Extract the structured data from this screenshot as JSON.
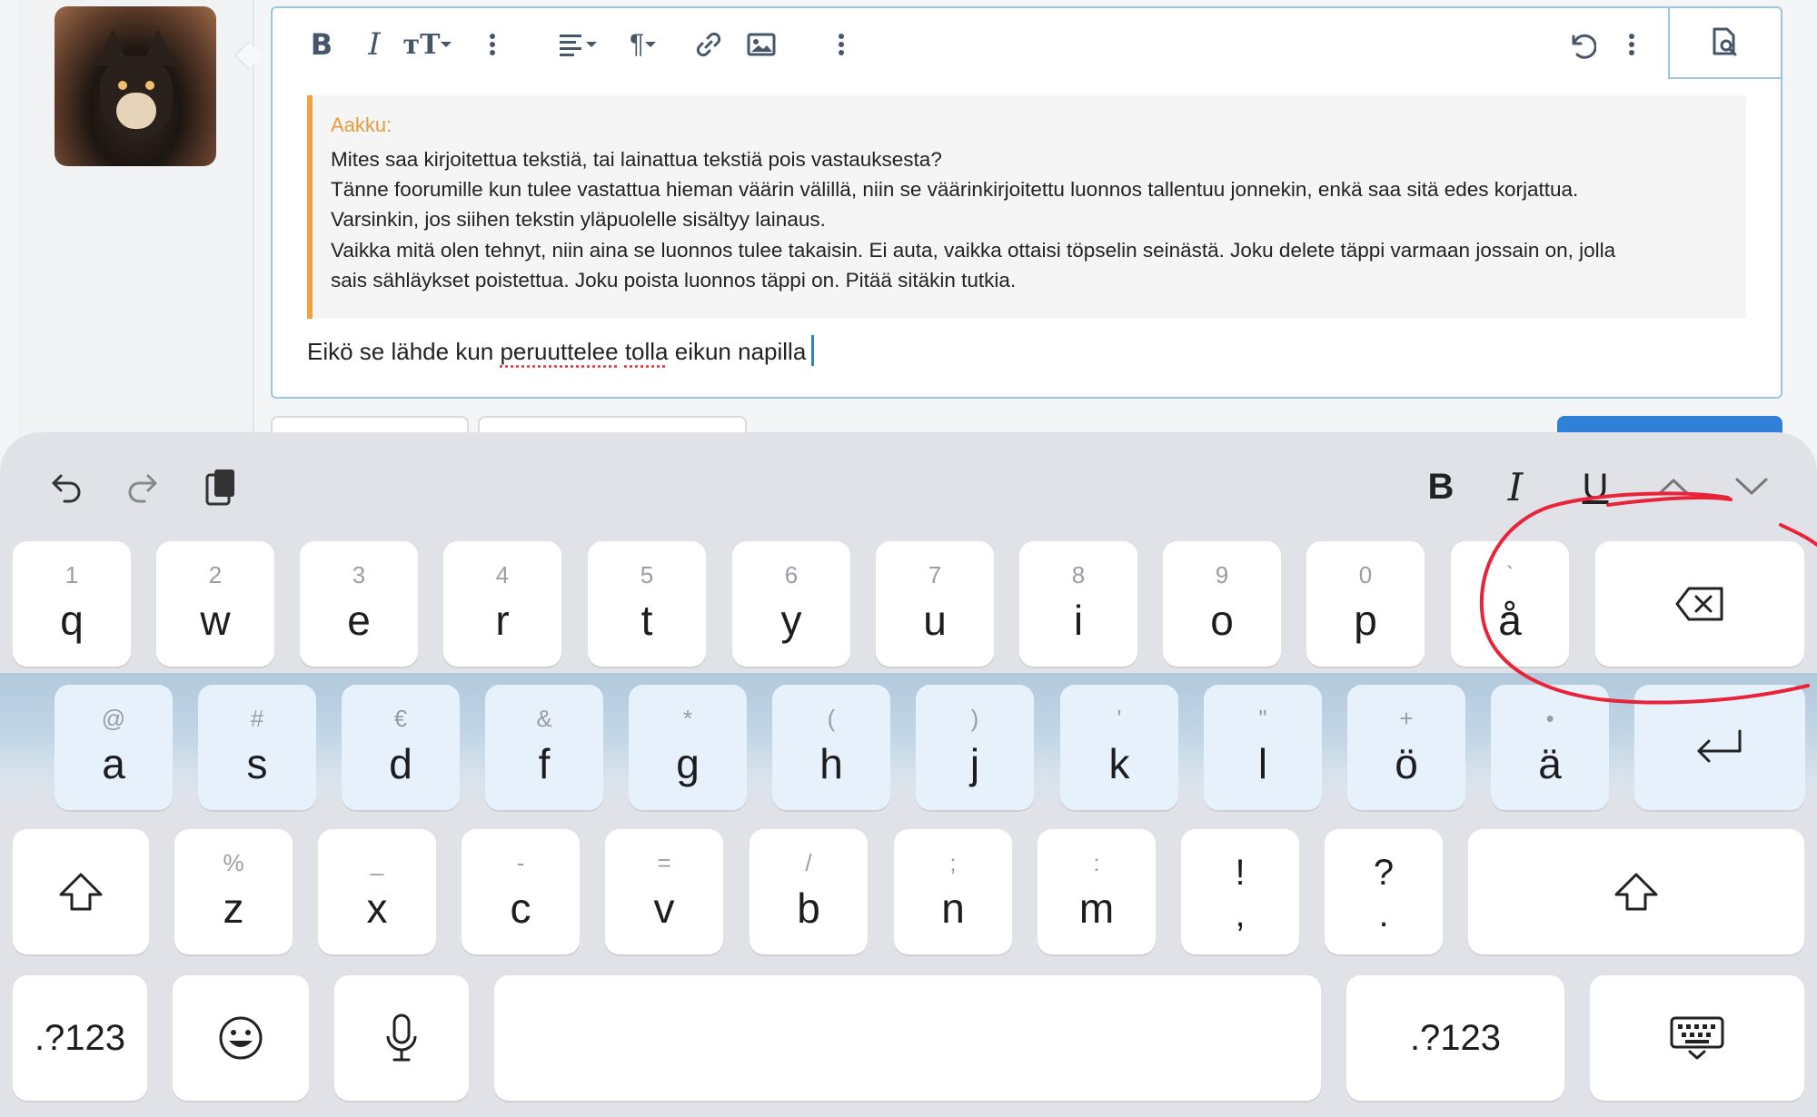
{
  "editor": {
    "toolbar": {
      "bold": "B",
      "italic": "I",
      "text_size": "тТ",
      "paragraph": "¶"
    },
    "quote": {
      "author": "Aakku:",
      "lines": [
        "Mites saa kirjoitettua tekstiä, tai lainattua tekstiä pois vastauksesta?",
        "Tänne foorumille kun tulee vastattua hieman väärin välillä, niin se väärinkirjoitettu luonnos tallentuu jonnekin, enkä saa sitä edes korjattua.",
        "Varsinkin, jos siihen tekstin yläpuolelle sisältyy lainaus.",
        "Vaikka mitä olen tehnyt, niin aina se luonnos tulee takaisin. Ei auta, vaikka ottaisi töpselin seinästä. Joku delete täppi varmaan jossain on, jolla",
        "sais sähläykset poistettua. Joku poista luonnos täppi on. Pitää sitäkin tutkia."
      ]
    },
    "reply": {
      "w1": "Eikö se lähde kun ",
      "w2": "peruuttelee",
      "w3": " ",
      "w4": "tolla",
      "w5": " eikun napilla"
    }
  },
  "keyboard": {
    "toolbar": {
      "bold": "B",
      "italic": "I",
      "underline": "U"
    },
    "row1": [
      {
        "hint": "1",
        "key": "q"
      },
      {
        "hint": "2",
        "key": "w"
      },
      {
        "hint": "3",
        "key": "e"
      },
      {
        "hint": "4",
        "key": "r"
      },
      {
        "hint": "5",
        "key": "t"
      },
      {
        "hint": "6",
        "key": "y"
      },
      {
        "hint": "7",
        "key": "u"
      },
      {
        "hint": "8",
        "key": "i"
      },
      {
        "hint": "9",
        "key": "o"
      },
      {
        "hint": "0",
        "key": "p"
      },
      {
        "hint": "`",
        "key": "å"
      }
    ],
    "row2": [
      {
        "hint": "@",
        "key": "a"
      },
      {
        "hint": "#",
        "key": "s"
      },
      {
        "hint": "€",
        "key": "d"
      },
      {
        "hint": "&",
        "key": "f"
      },
      {
        "hint": "*",
        "key": "g"
      },
      {
        "hint": "(",
        "key": "h"
      },
      {
        "hint": ")",
        "key": "j"
      },
      {
        "hint": "'",
        "key": "k"
      },
      {
        "hint": "\"",
        "key": "l"
      },
      {
        "hint": "+",
        "key": "ö"
      },
      {
        "hint": "•",
        "key": "ä"
      }
    ],
    "row3": [
      {
        "hint": "%",
        "key": "z"
      },
      {
        "hint": "_",
        "key": "x"
      },
      {
        "hint": "-",
        "key": "c"
      },
      {
        "hint": "=",
        "key": "v"
      },
      {
        "hint": "/",
        "key": "b"
      },
      {
        "hint": ";",
        "key": "n"
      },
      {
        "hint": ":",
        "key": "m"
      }
    ],
    "punct": [
      {
        "top": "!",
        "bottom": ","
      },
      {
        "top": "?",
        "bottom": "."
      }
    ],
    "numbers_left": ".?123",
    "numbers_right": ".?123",
    "band_color": "#b9d0e4",
    "annotation_color": "#e8233a"
  }
}
